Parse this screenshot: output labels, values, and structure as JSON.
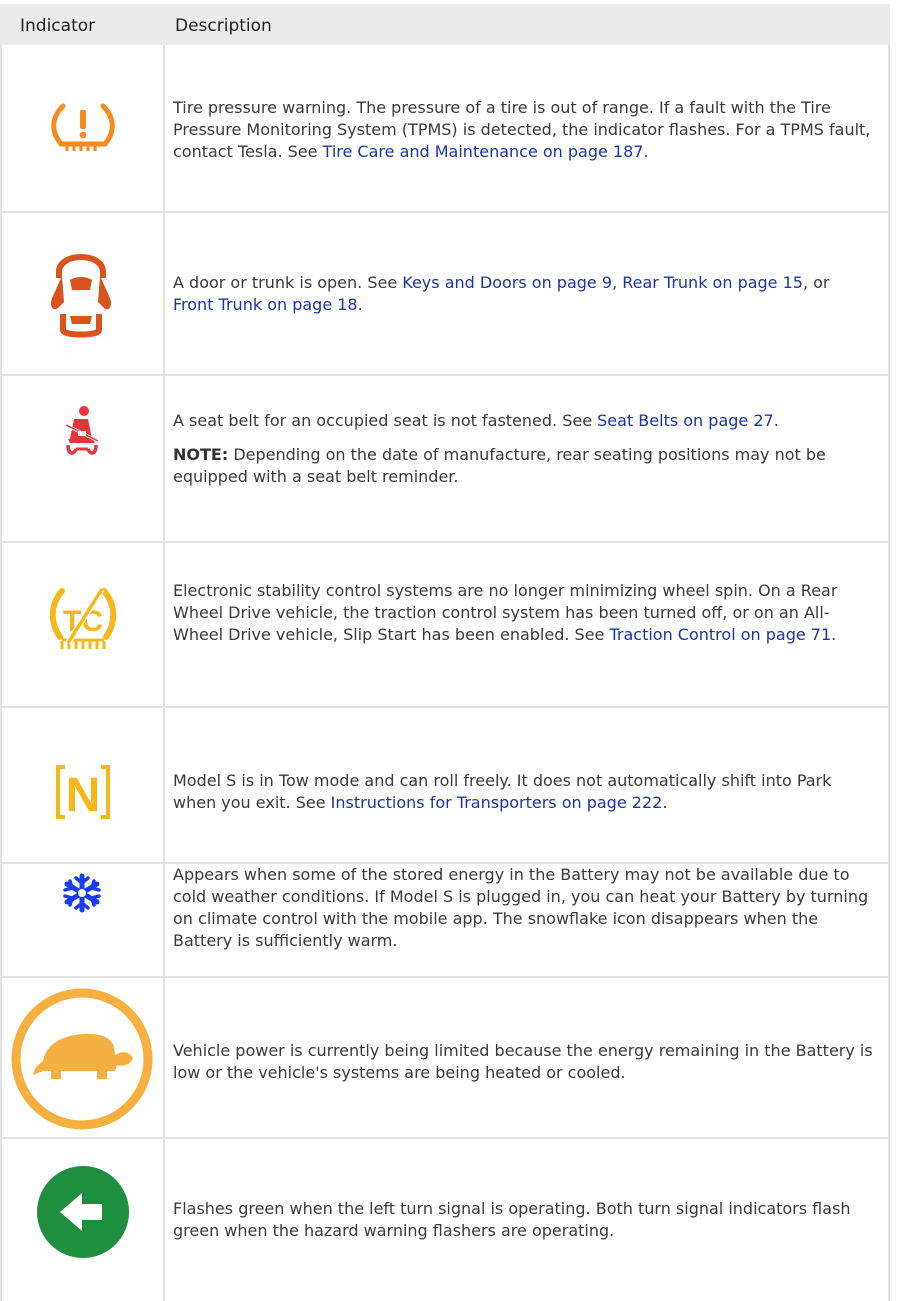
{
  "header": {
    "col_indicator": "Indicator",
    "col_description": "Description"
  },
  "rows": [
    {
      "icon": "tire-pressure-warning-icon",
      "icon_color": "#F58A1F",
      "text": "Tire pressure warning. The pressure of a tire is out of range. If a fault with the Tire Pressure Monitoring System (TPMS) is detected, the indicator flashes. For a TPMS fault, contact Tesla. See ",
      "link": "Tire Care and Maintenance on page 187",
      "after": "."
    },
    {
      "icon": "door-open-icon",
      "icon_color": "#D9531E",
      "text": "A door or trunk is open. See ",
      "link1": "Keys and Doors on page 9",
      "mid1": ", ",
      "link2": "Rear Trunk on page 15",
      "mid2": ", or ",
      "link3": "Front Trunk on page 18",
      "after": "."
    },
    {
      "icon": "seat-belt-icon",
      "icon_color": "#E8343A",
      "text": "A seat belt for an occupied seat is not fastened. See ",
      "link": "Seat Belts on page 27",
      "after": ".",
      "note_label": "NOTE:",
      "note_text": " Depending on the date of manufacture, rear seating positions may not be equipped with a seat belt reminder."
    },
    {
      "icon": "traction-control-off-icon",
      "icon_color": "#F5B81C",
      "icon_label": "TC",
      "text": "Electronic stability control systems are no longer minimizing wheel spin. On a Rear Wheel Drive vehicle, the traction control system has been turned off, or on an All-Wheel Drive vehicle, Slip Start has been enabled. See ",
      "link": "Traction Control on page 71",
      "after": "."
    },
    {
      "icon": "tow-mode-icon",
      "icon_color": "#F5B81C",
      "icon_label": "N",
      "text": "Model S is in Tow mode and can roll freely. It does not automatically shift into Park when you exit. See ",
      "link": "Instructions for Transporters on page 222",
      "after": "."
    },
    {
      "icon": "snowflake-icon",
      "icon_color": "#1A3CF0",
      "text": "Appears when some of the stored energy in the Battery may not be available due to cold weather conditions. If Model S is plugged in, you can heat your Battery by turning on climate control with the mobile app. The snowflake icon disappears when the Battery is sufficiently warm."
    },
    {
      "icon": "turtle-power-limited-icon",
      "icon_color": "#F5B040",
      "text": "Vehicle power is currently being limited because the energy remaining in the Battery is low or the vehicle's systems are being heated or cooled."
    },
    {
      "icon": "left-turn-signal-icon",
      "icon_color": "#1E8F3C",
      "text": "Flashes green when the left turn signal is operating. Both turn signal indicators flash green when the hazard warning flashers are operating."
    }
  ]
}
